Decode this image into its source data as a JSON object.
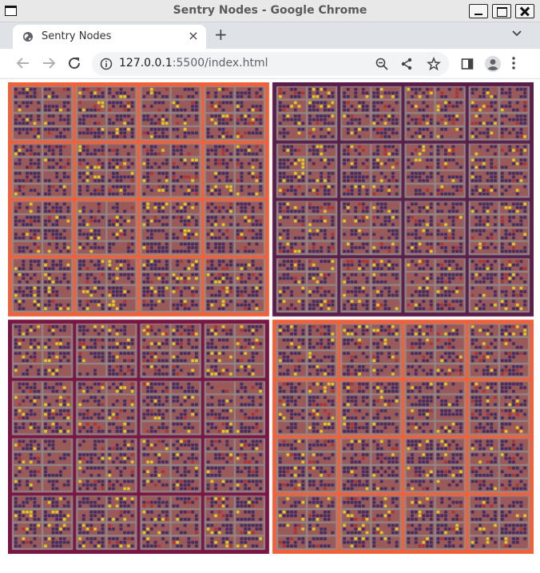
{
  "window": {
    "title": "Sentry Nodes - Google Chrome"
  },
  "tab": {
    "title": "Sentry Nodes",
    "close_glyph": "×",
    "new_tab_glyph": "+"
  },
  "omnibox": {
    "url_host": "127.0.0.1",
    "url_rest": ":5500/index.html"
  },
  "icons": [
    "window-icon",
    "minimize-icon",
    "maximize-icon",
    "close-icon",
    "globe-icon",
    "tab-search-icon",
    "back-arrow-icon",
    "forward-arrow-icon",
    "reload-icon",
    "site-info-icon",
    "zoom-out-icon",
    "share-icon",
    "bookmark-star-icon",
    "side-panel-icon",
    "profile-icon",
    "kebab-menu-icon"
  ],
  "colors": {
    "node_gray": "#8e8e8e",
    "node_brown": "#9b5a5a",
    "quadrant_orange": "#f0603a",
    "quadrant_purple": "#5b1e4b",
    "quadrant_maroon": "#7a1443",
    "dot_dark": "#3a2a63",
    "dot_yellow": "#e6d025",
    "dot_red": "#b03030"
  },
  "quadrants": [
    {
      "id": "top-left",
      "color": "orange"
    },
    {
      "id": "top-right",
      "color": "purple"
    },
    {
      "id": "bottom-left",
      "color": "maroon"
    },
    {
      "id": "bottom-right",
      "color": "orange"
    }
  ]
}
